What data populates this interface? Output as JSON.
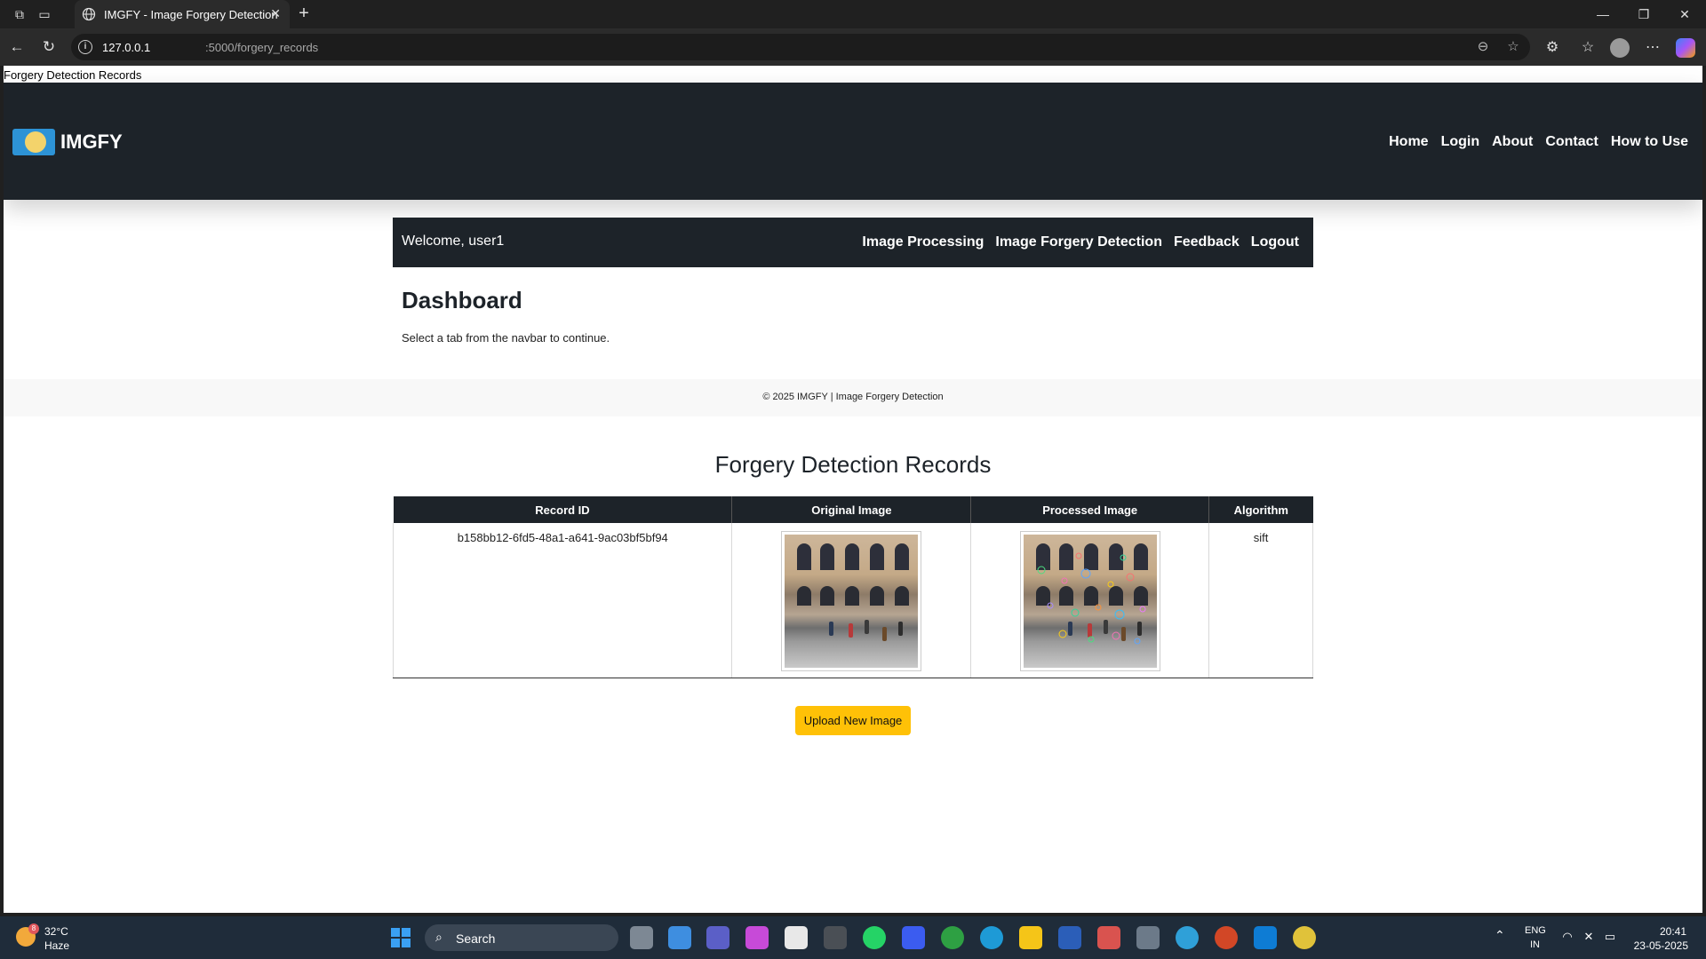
{
  "browser": {
    "tab_title": "IMGFY - Image Forgery Detection",
    "url_host": "127.0.0.1",
    "url_path": ":5000/forgery_records"
  },
  "page": {
    "document_title": "Forgery Detection Records",
    "brand": "IMGFY",
    "main_nav": [
      "Home",
      "Login",
      "About",
      "Contact",
      "How to Use"
    ],
    "welcome": "Welcome, user1",
    "dash_nav": [
      "Image Processing",
      "Image Forgery Detection",
      "Feedback",
      "Logout"
    ],
    "dashboard_title": "Dashboard",
    "dashboard_subtitle": "Select a tab from the navbar to continue.",
    "footer": "© 2025 IMGFY | Image Forgery Detection",
    "records_title": "Forgery Detection Records",
    "table": {
      "headers": [
        "Record ID",
        "Original Image",
        "Processed Image",
        "Algorithm"
      ],
      "rows": [
        {
          "record_id": "b158bb12-6fd5-48a1-a641-9ac03bf5bf94",
          "algorithm": "sift"
        }
      ]
    },
    "upload_button": "Upload New Image"
  },
  "taskbar": {
    "weather_temp": "32°C",
    "weather_condition": "Haze",
    "weather_badge": "8",
    "search_label": "Search",
    "lang_top": "ENG",
    "lang_bottom": "IN",
    "time": "20:41",
    "date": "23-05-2025"
  },
  "colors": {
    "header_bg": "#1d2329",
    "button_accent": "#ffc107"
  }
}
